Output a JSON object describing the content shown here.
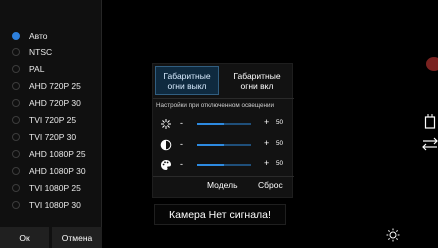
{
  "format_menu": {
    "items": [
      {
        "label": "Авто",
        "selected": true
      },
      {
        "label": "NTSC",
        "selected": false
      },
      {
        "label": "PAL",
        "selected": false
      },
      {
        "label": "AHD 720P 25",
        "selected": false
      },
      {
        "label": "AHD 720P 30",
        "selected": false
      },
      {
        "label": "TVI 720P 25",
        "selected": false
      },
      {
        "label": "TVI 720P 30",
        "selected": false
      },
      {
        "label": "AHD 1080P 25",
        "selected": false
      },
      {
        "label": "AHD 1080P 30",
        "selected": false
      },
      {
        "label": "TVI 1080P 25",
        "selected": false
      },
      {
        "label": "TVI 1080P 30",
        "selected": false
      }
    ],
    "ok_label": "Ок",
    "cancel_label": "Отмена"
  },
  "light_panel": {
    "mode_off_label": "Габаритные огни выкл",
    "mode_on_label": "Габаритные огни вкл",
    "selected_mode": "off",
    "caption": "Настройки при отключенном освещении",
    "sliders": [
      {
        "icon": "brightness-icon",
        "value": 50,
        "level": 0.5,
        "minus": "-",
        "plus": "+"
      },
      {
        "icon": "contrast-icon",
        "value": 50,
        "level": 0.5,
        "minus": "-",
        "plus": "+"
      },
      {
        "icon": "palette-icon",
        "value": 50,
        "level": 0.5,
        "minus": "-",
        "plus": "+"
      }
    ],
    "model_label": "Модель",
    "reset_label": "Сброс"
  },
  "camera": {
    "status_text": "Камера Нет сигнала!"
  },
  "icons": {
    "edge_top": "cup-icon",
    "edge_bottom": "swap-arrows-icon",
    "bottom_right": "sun-icon"
  },
  "colors": {
    "accent": "#2d7fdb",
    "selected_mode_bg": "#0f2a3f",
    "record": "#7a2220"
  }
}
